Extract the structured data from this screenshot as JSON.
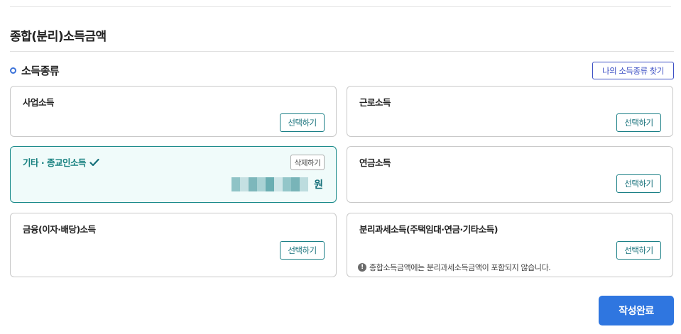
{
  "page": {
    "title": "종합(분리)소득금액"
  },
  "section": {
    "label": "소득종류",
    "find_button_label": "나의 소득종류 찾기"
  },
  "cards": {
    "business": {
      "title": "사업소득",
      "button_label": "선택하기"
    },
    "earned": {
      "title": "근로소득",
      "button_label": "선택하기"
    },
    "other": {
      "title": "기타 · 종교인소득",
      "delete_label": "삭제하기",
      "amount_masked": true,
      "unit": "원",
      "selected": true
    },
    "pension": {
      "title": "연금소득",
      "button_label": "선택하기"
    },
    "financial": {
      "title": "금융(이자·배당)소득",
      "button_label": "선택하기"
    },
    "separate": {
      "title": "분리과세소득(주택임대·연금·기타소득)",
      "button_label": "선택하기",
      "notice": "종합소득금액에는 분리과세소득금액이 포함되지 않습니다."
    }
  },
  "footer": {
    "submit_label": "작성완료"
  },
  "colors": {
    "accent_teal": "#16707a",
    "selected_bg": "#f0fbfa",
    "primary_blue": "#2f76e0",
    "find_button": "#3c4fc4"
  },
  "icons": {
    "section_bullet": "ring-bullet-icon",
    "selected_mark": "check-icon",
    "notice": "info-icon"
  }
}
